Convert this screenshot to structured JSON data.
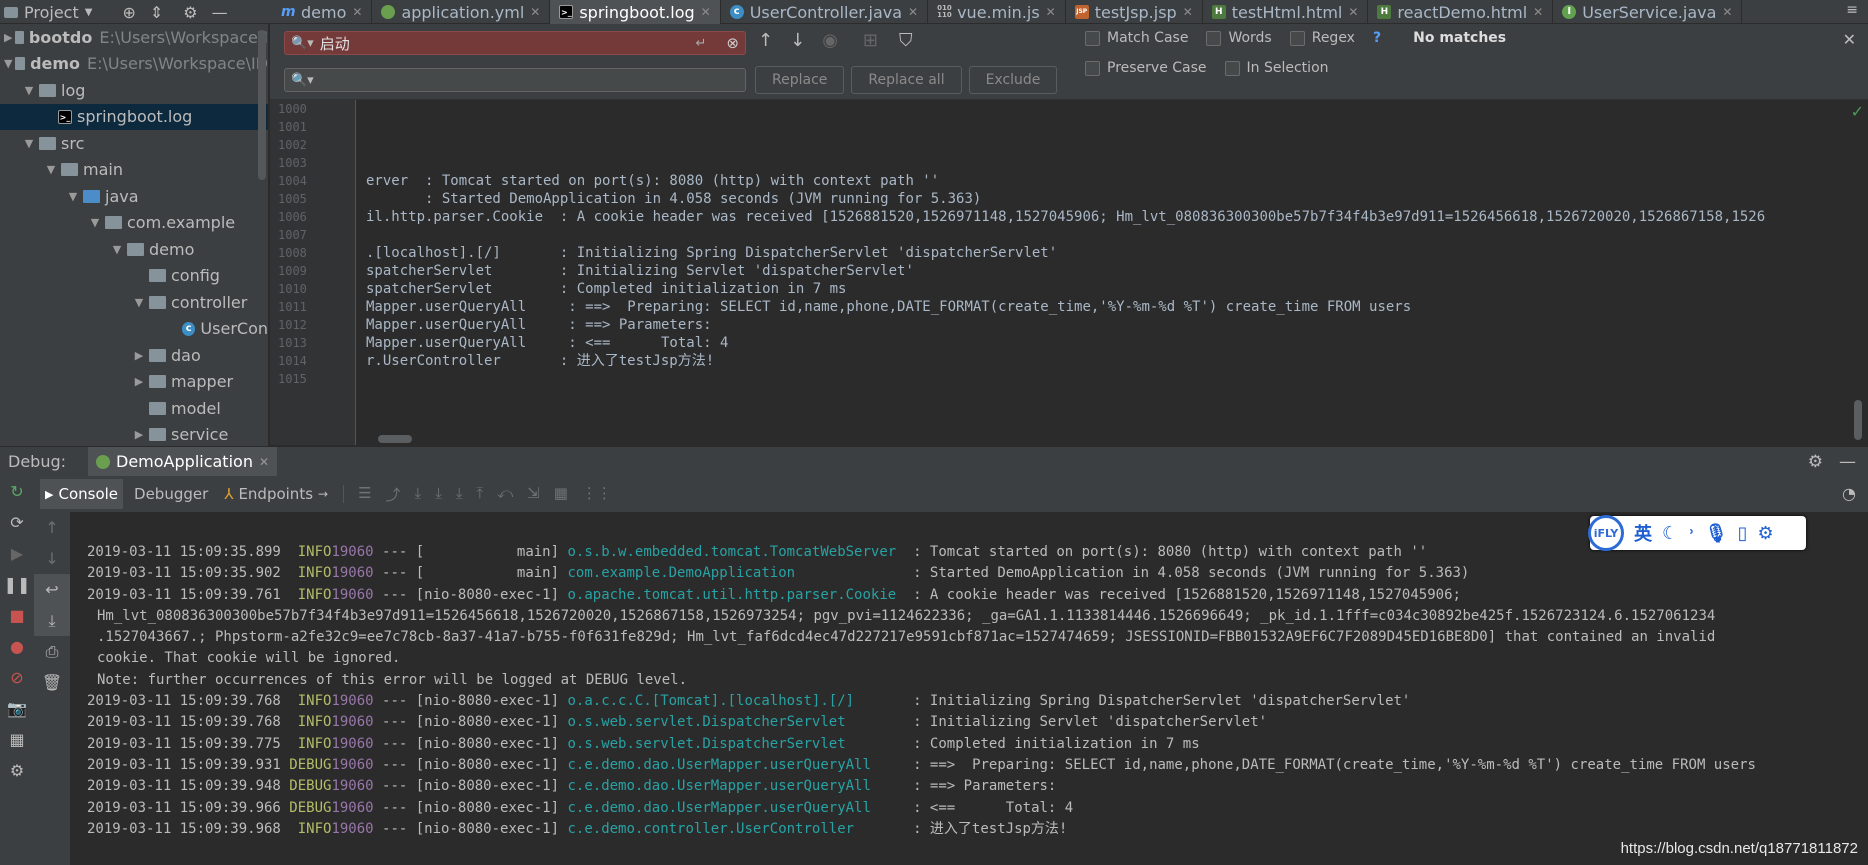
{
  "project": {
    "title": "Project"
  },
  "tabs": [
    {
      "label": "demo",
      "icon": "m-icon"
    },
    {
      "label": "application.yml",
      "icon": "spring-icon"
    },
    {
      "label": "springboot.log",
      "icon": "log-icon",
      "active": true
    },
    {
      "label": "UserController.java",
      "icon": "class-icon"
    },
    {
      "label": "vue.min.js",
      "icon": "js-icon"
    },
    {
      "label": "testJsp.jsp",
      "icon": "jsp-icon"
    },
    {
      "label": "testHtml.html",
      "icon": "html-icon"
    },
    {
      "label": "reactDemo.html",
      "icon": "html-icon"
    },
    {
      "label": "UserService.java",
      "icon": "interface-icon"
    }
  ],
  "tree": [
    {
      "label": "bootdo",
      "path": "E:\\Users\\Workspace\\I",
      "bold": true
    },
    {
      "label": "demo",
      "path": "E:\\Users\\Workspace\\ID",
      "bold": true
    },
    {
      "label": "log"
    },
    {
      "label": "springboot.log"
    },
    {
      "label": "src"
    },
    {
      "label": "main"
    },
    {
      "label": "java"
    },
    {
      "label": "com.example"
    },
    {
      "label": "demo"
    },
    {
      "label": "config"
    },
    {
      "label": "controller"
    },
    {
      "label": "UserCon"
    },
    {
      "label": "dao"
    },
    {
      "label": "mapper"
    },
    {
      "label": "model"
    },
    {
      "label": "service"
    }
  ],
  "find": {
    "query": "启动",
    "replace": "",
    "match_case": "Match Case",
    "words": "Words",
    "regex": "Regex",
    "help": "?",
    "status": "No matches",
    "preserve_case": "Preserve Case",
    "in_selection": "In Selection",
    "replace_btn": "Replace",
    "replace_all_btn": "Replace all",
    "exclude_btn": "Exclude"
  },
  "editor": {
    "line_numbers": [
      "1000",
      "1001",
      "1002",
      "1003",
      "1004",
      "1005",
      "1006",
      "1007",
      "1008",
      "1009",
      "1010",
      "1011",
      "1012",
      "1013",
      "1014",
      "1015"
    ],
    "lines": [
      "",
      "",
      "",
      "",
      "erver  : Tomcat started on port(s): 8080 (http) with context path ''",
      "       : Started DemoApplication in 4.058 seconds (JVM running for 5.363)",
      "il.http.parser.Cookie  : A cookie header was received [1526881520,1526971148,1527045906; Hm_lvt_080836300300be57b7f34f4b3e97d911=1526456618,1526720020,1526867158,1526",
      "",
      ".[localhost].[/]       : Initializing Spring DispatcherServlet 'dispatcherServlet'",
      "spatcherServlet        : Initializing Servlet 'dispatcherServlet'",
      "spatcherServlet        : Completed initialization in 7 ms",
      "Mapper.userQueryAll     : ==>  Preparing: SELECT id,name,phone,DATE_FORMAT(create_time,'%Y-%m-%d %T') create_time FROM users",
      "Mapper.userQueryAll     : ==> Parameters: ",
      "Mapper.userQueryAll     : <==      Total: 4",
      "r.UserController       : 进入了testJsp方法!",
      ""
    ]
  },
  "debug": {
    "label": "Debug:",
    "run_tab": "DemoApplication"
  },
  "debug_tabs": {
    "console": "Console",
    "debugger": "Debugger",
    "endpoints": "Endpoints"
  },
  "console": {
    "rows": [
      {
        "ts": "2019-03-11 15:09:35.899",
        "lv": "  INFO",
        "pid": "19060",
        "th": " --- [           main] ",
        "lg": "o.s.b.w.embedded.tomcat.TomcatWebServer ",
        "msg": " : Tomcat started on port(s): 8080 (http) with context path ''"
      },
      {
        "ts": "2019-03-11 15:09:35.902",
        "lv": "  INFO",
        "pid": "19060",
        "th": " --- [           main] ",
        "lg": "com.example.DemoApplication             ",
        "msg": " : Started DemoApplication in 4.058 seconds (JVM running for 5.363)"
      },
      {
        "ts": "2019-03-11 15:09:39.761",
        "lv": "  INFO",
        "pid": "19060",
        "th": " --- [nio-8080-exec-1] ",
        "lg": "o.apache.tomcat.util.http.parser.Cookie ",
        "msg": " : A cookie header was received [1526881520,1526971148,1527045906;"
      },
      {
        "cont": "Hm_lvt_080836300300be57b7f34f4b3e97d911=1526456618,1526720020,1526867158,1526973254; pgv_pvi=1124622336; _ga=GA1.1.1133814446.1526696649; _pk_id.1.1fff=c034c30892be425f.1526723124.6.1527061234"
      },
      {
        "cont": ".1527043667.; Phpstorm-a2fe32c9=ee7c78cb-8a37-41a7-b755-f0f631fe829d; Hm_lvt_faf6dcd4ec47d227217e9591cbf871ac=1527474659; JSESSIONID=FBB01532A9EF6C7F2089D45ED16BE8D0] that contained an invalid"
      },
      {
        "cont": "cookie. That cookie will be ignored."
      },
      {
        "cont": "Note: further occurrences of this error will be logged at DEBUG level."
      },
      {
        "ts": "2019-03-11 15:09:39.768",
        "lv": "  INFO",
        "pid": "19060",
        "th": " --- [nio-8080-exec-1] ",
        "lg": "o.a.c.c.C.[Tomcat].[localhost].[/]      ",
        "msg": " : Initializing Spring DispatcherServlet 'dispatcherServlet'"
      },
      {
        "ts": "2019-03-11 15:09:39.768",
        "lv": "  INFO",
        "pid": "19060",
        "th": " --- [nio-8080-exec-1] ",
        "lg": "o.s.web.servlet.DispatcherServlet       ",
        "msg": " : Initializing Servlet 'dispatcherServlet'"
      },
      {
        "ts": "2019-03-11 15:09:39.775",
        "lv": "  INFO",
        "pid": "19060",
        "th": " --- [nio-8080-exec-1] ",
        "lg": "o.s.web.servlet.DispatcherServlet       ",
        "msg": " : Completed initialization in 7 ms"
      },
      {
        "ts": "2019-03-11 15:09:39.931",
        "lv": " DEBUG",
        "pid": "19060",
        "th": " --- [nio-8080-exec-1] ",
        "lg": "c.e.demo.dao.UserMapper.userQueryAll    ",
        "msg": " : ==>  Preparing: SELECT id,name,phone,DATE_FORMAT(create_time,'%Y-%m-%d %T') create_time FROM users"
      },
      {
        "ts": "2019-03-11 15:09:39.948",
        "lv": " DEBUG",
        "pid": "19060",
        "th": " --- [nio-8080-exec-1] ",
        "lg": "c.e.demo.dao.UserMapper.userQueryAll    ",
        "msg": " : ==> Parameters: "
      },
      {
        "ts": "2019-03-11 15:09:39.966",
        "lv": " DEBUG",
        "pid": "19060",
        "th": " --- [nio-8080-exec-1] ",
        "lg": "c.e.demo.dao.UserMapper.userQueryAll    ",
        "msg": " : <==      Total: 4"
      },
      {
        "ts": "2019-03-11 15:09:39.968",
        "lv": "  INFO",
        "pid": "19060",
        "th": " --- [nio-8080-exec-1] ",
        "lg": "c.e.demo.controller.UserController      ",
        "msg": " : 进入了testJsp方法!"
      }
    ]
  },
  "ime": {
    "logo": "iFLY",
    "lang": "英"
  },
  "watermark": "https://blog.csdn.net/q18771811872"
}
